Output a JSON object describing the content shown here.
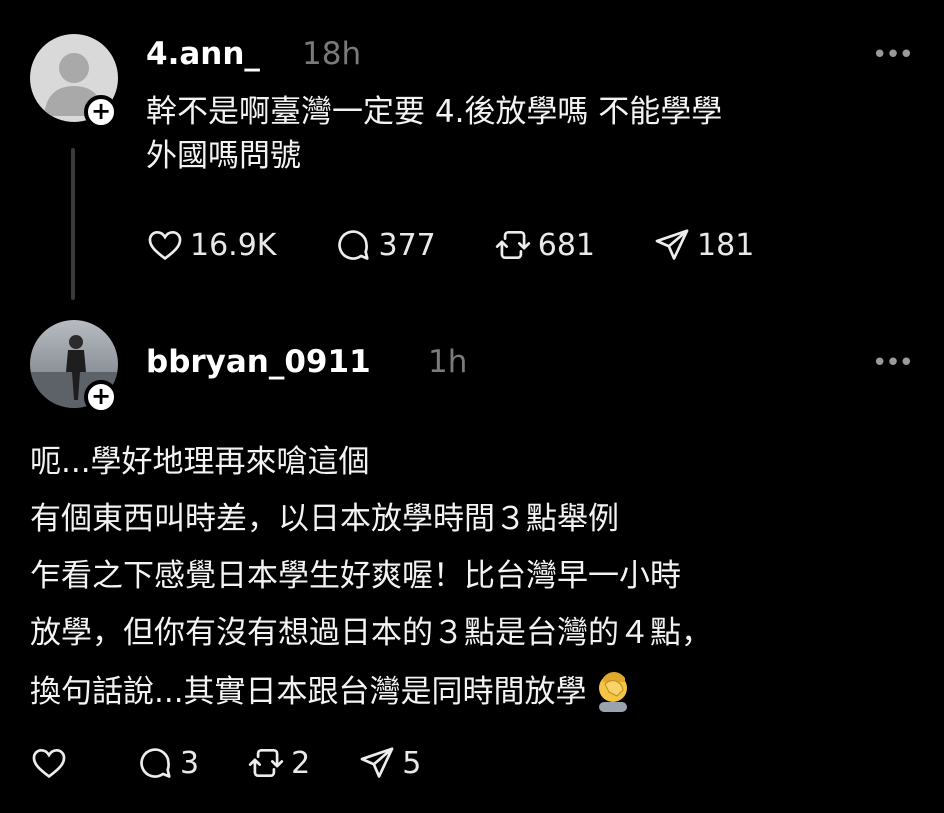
{
  "post1": {
    "username": "4.ann_",
    "time": "18h",
    "more": "•••",
    "text": "幹不是啊臺灣一定要 4.後放學嗎 不能學學\n外國嗎問號",
    "likes": "16.9K",
    "comments": "377",
    "reposts": "681",
    "shares": "181"
  },
  "post2": {
    "username": "bbryan_0911",
    "time": "1h",
    "more": "•••",
    "lines": [
      "呃...學好地理再來嗆這個",
      "有個東西叫時差，以日本放學時間３點舉例",
      "乍看之下感覺日本學生好爽喔！比台灣早一小時",
      "放學，但你有沒有想過日本的３點是台灣的４點，",
      "換句話說...其實日本跟台灣是同時間放學"
    ],
    "likes": "",
    "comments": "3",
    "reposts": "2",
    "shares": "5"
  },
  "badge": "+",
  "icons": [
    "heart-icon",
    "comment-icon",
    "repost-icon",
    "share-icon",
    "facepalm-emoji",
    "more-icon",
    "plus-icon"
  ]
}
